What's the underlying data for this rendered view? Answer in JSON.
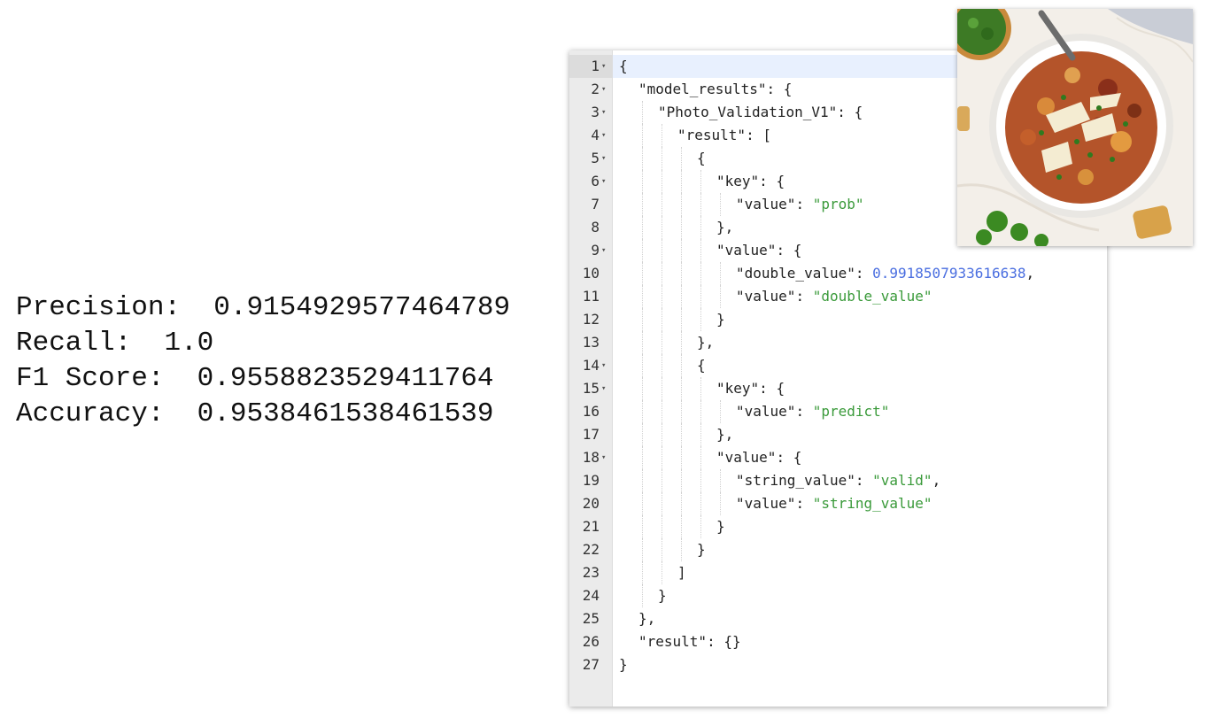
{
  "metrics": [
    {
      "label": "Precision:",
      "value": "0.9154929577464789"
    },
    {
      "label": "Recall:",
      "value": "1.0"
    },
    {
      "label": "F1 Score:",
      "value": "0.9558823529411764"
    },
    {
      "label": "Accuracy:",
      "value": "0.9538461538461539"
    }
  ],
  "editor": {
    "lines": [
      {
        "n": "1",
        "fold": true,
        "indent": 0,
        "parts": [
          {
            "t": "{",
            "c": "p"
          }
        ]
      },
      {
        "n": "2",
        "fold": true,
        "indent": 1,
        "parts": [
          {
            "t": "\"model_results\"",
            "c": "k"
          },
          {
            "t": ": {",
            "c": "p"
          }
        ]
      },
      {
        "n": "3",
        "fold": true,
        "indent": 2,
        "parts": [
          {
            "t": "\"Photo_Validation_V1\"",
            "c": "k"
          },
          {
            "t": ": {",
            "c": "p"
          }
        ]
      },
      {
        "n": "4",
        "fold": true,
        "indent": 3,
        "parts": [
          {
            "t": "\"result\"",
            "c": "k"
          },
          {
            "t": ": [",
            "c": "p"
          }
        ]
      },
      {
        "n": "5",
        "fold": true,
        "indent": 4,
        "parts": [
          {
            "t": "{",
            "c": "p"
          }
        ]
      },
      {
        "n": "6",
        "fold": true,
        "indent": 5,
        "parts": [
          {
            "t": "\"key\"",
            "c": "k"
          },
          {
            "t": ": {",
            "c": "p"
          }
        ]
      },
      {
        "n": "7",
        "fold": false,
        "indent": 6,
        "parts": [
          {
            "t": "\"value\"",
            "c": "k"
          },
          {
            "t": ": ",
            "c": "p"
          },
          {
            "t": "\"prob\"",
            "c": "s"
          }
        ]
      },
      {
        "n": "8",
        "fold": false,
        "indent": 5,
        "parts": [
          {
            "t": "},",
            "c": "p"
          }
        ]
      },
      {
        "n": "9",
        "fold": true,
        "indent": 5,
        "parts": [
          {
            "t": "\"value\"",
            "c": "k"
          },
          {
            "t": ": {",
            "c": "p"
          }
        ]
      },
      {
        "n": "10",
        "fold": false,
        "indent": 6,
        "parts": [
          {
            "t": "\"double_value\"",
            "c": "k"
          },
          {
            "t": ": ",
            "c": "p"
          },
          {
            "t": "0.9918507933616638",
            "c": "n"
          },
          {
            "t": ",",
            "c": "p"
          }
        ]
      },
      {
        "n": "11",
        "fold": false,
        "indent": 6,
        "parts": [
          {
            "t": "\"value\"",
            "c": "k"
          },
          {
            "t": ": ",
            "c": "p"
          },
          {
            "t": "\"double_value\"",
            "c": "s"
          }
        ]
      },
      {
        "n": "12",
        "fold": false,
        "indent": 5,
        "parts": [
          {
            "t": "}",
            "c": "p"
          }
        ]
      },
      {
        "n": "13",
        "fold": false,
        "indent": 4,
        "parts": [
          {
            "t": "},",
            "c": "p"
          }
        ]
      },
      {
        "n": "14",
        "fold": true,
        "indent": 4,
        "parts": [
          {
            "t": "{",
            "c": "p"
          }
        ]
      },
      {
        "n": "15",
        "fold": true,
        "indent": 5,
        "parts": [
          {
            "t": "\"key\"",
            "c": "k"
          },
          {
            "t": ": {",
            "c": "p"
          }
        ]
      },
      {
        "n": "16",
        "fold": false,
        "indent": 6,
        "parts": [
          {
            "t": "\"value\"",
            "c": "k"
          },
          {
            "t": ": ",
            "c": "p"
          },
          {
            "t": "\"predict\"",
            "c": "s"
          }
        ]
      },
      {
        "n": "17",
        "fold": false,
        "indent": 5,
        "parts": [
          {
            "t": "},",
            "c": "p"
          }
        ]
      },
      {
        "n": "18",
        "fold": true,
        "indent": 5,
        "parts": [
          {
            "t": "\"value\"",
            "c": "k"
          },
          {
            "t": ": {",
            "c": "p"
          }
        ]
      },
      {
        "n": "19",
        "fold": false,
        "indent": 6,
        "parts": [
          {
            "t": "\"string_value\"",
            "c": "k"
          },
          {
            "t": ": ",
            "c": "p"
          },
          {
            "t": "\"valid\"",
            "c": "s"
          },
          {
            "t": ",",
            "c": "p"
          }
        ]
      },
      {
        "n": "20",
        "fold": false,
        "indent": 6,
        "parts": [
          {
            "t": "\"value\"",
            "c": "k"
          },
          {
            "t": ": ",
            "c": "p"
          },
          {
            "t": "\"string_value\"",
            "c": "s"
          }
        ]
      },
      {
        "n": "21",
        "fold": false,
        "indent": 5,
        "parts": [
          {
            "t": "}",
            "c": "p"
          }
        ]
      },
      {
        "n": "22",
        "fold": false,
        "indent": 4,
        "parts": [
          {
            "t": "}",
            "c": "p"
          }
        ]
      },
      {
        "n": "23",
        "fold": false,
        "indent": 3,
        "parts": [
          {
            "t": "]",
            "c": "p"
          }
        ]
      },
      {
        "n": "24",
        "fold": false,
        "indent": 2,
        "parts": [
          {
            "t": "}",
            "c": "p"
          }
        ]
      },
      {
        "n": "25",
        "fold": false,
        "indent": 1,
        "parts": [
          {
            "t": "},",
            "c": "p"
          }
        ]
      },
      {
        "n": "26",
        "fold": false,
        "indent": 1,
        "parts": [
          {
            "t": "\"result\"",
            "c": "k"
          },
          {
            "t": ": {}",
            "c": "p"
          }
        ]
      },
      {
        "n": "27",
        "fold": false,
        "indent": 0,
        "parts": [
          {
            "t": "}",
            "c": "p"
          }
        ]
      }
    ],
    "colors": {
      "string": "#3a9a3a",
      "number": "#4a6ee0",
      "key": "#222222",
      "active_line": "#e8f0fe"
    }
  },
  "photo": {
    "icon": "food-bowl-image"
  }
}
